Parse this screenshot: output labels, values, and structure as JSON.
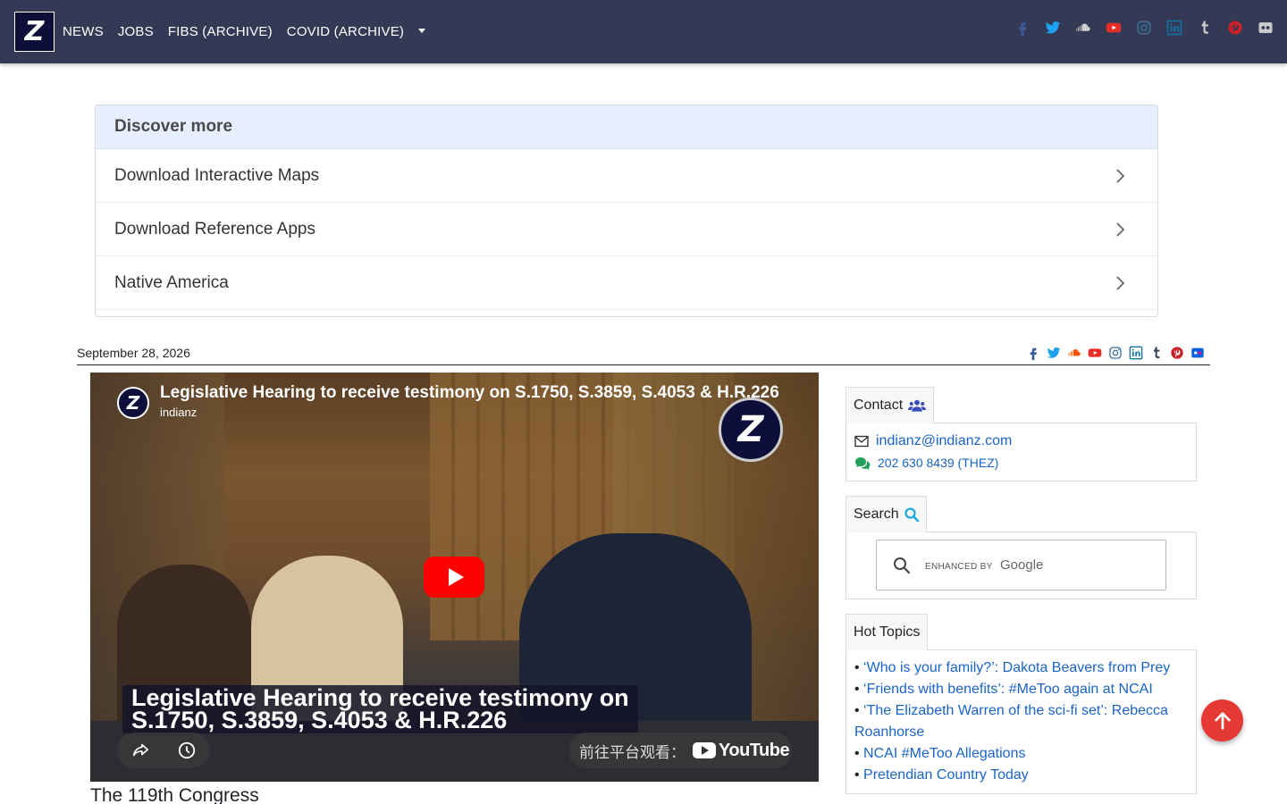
{
  "navbar": {
    "logo_letter": "Z",
    "links": [
      "NEWS",
      "JOBS",
      "FIBS (ARCHIVE)",
      "COVID (ARCHIVE)"
    ],
    "social_icons": [
      "facebook-icon",
      "twitter-icon",
      "soundcloud-icon",
      "youtube-icon",
      "instagram-icon",
      "linkedin-icon",
      "tumblr-icon",
      "pinterest-icon",
      "flickr-icon"
    ]
  },
  "discover": {
    "heading": "Discover more",
    "items": [
      "Download Interactive Maps",
      "Download Reference Apps",
      "Native America"
    ]
  },
  "date_bar": {
    "date": "September 28, 2026"
  },
  "video": {
    "title": "Legislative Hearing to receive testimony on S.1750, S.3859, S.4053 & H.R.226",
    "channel": "indianz",
    "avatar_letter": "Z",
    "caption_line1": "Legislative Hearing to receive testimony on",
    "caption_line2": "S.1750, S.3859, S.4053 & H.R.226",
    "watch_on_label": "前往平台观看：",
    "platform": "YouTube"
  },
  "section_title": "The 119th Congress",
  "sidebar": {
    "contact": {
      "title": "Contact",
      "email": "indianz@indianz.com",
      "phone": "202 630 8439 (THEZ)"
    },
    "search": {
      "title": "Search",
      "enhanced_by": "ENHANCED BY",
      "provider": "Google"
    },
    "hot_topics": {
      "title": "Hot Topics",
      "items": [
        "‘Who is your family?’: Dakota Beavers from Prey",
        "‘Friends with benefits’: #MeToo again at NCAI",
        "‘The Elizabeth Warren of the sci-fi set’: Rebecca Roanhorse",
        "NCAI #MeToo Allegations",
        "Pretendian Country Today"
      ]
    }
  },
  "colors": {
    "navbar": "#343a55",
    "link": "#1a64c9",
    "fab": "#e53935",
    "discover_header": "#e6efff"
  }
}
